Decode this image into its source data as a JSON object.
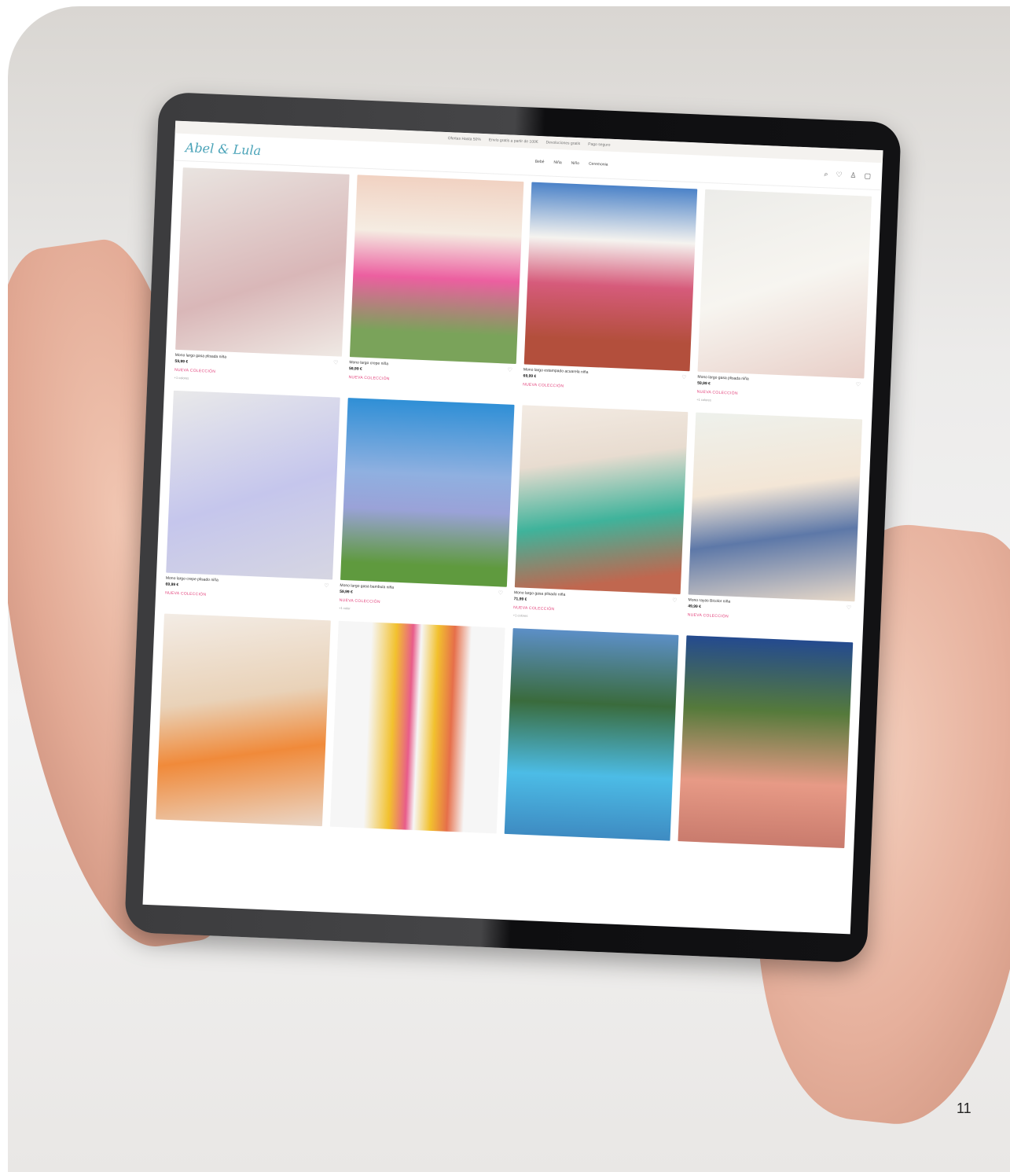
{
  "promo_bar": [
    "Ofertas Hasta 50%",
    "Envío gratis a partir de 100€",
    "Devoluciones gratis",
    "Pago seguro"
  ],
  "brand": "Abel & Lula",
  "nav": [
    "Bebé",
    "Niña",
    "Niño",
    "Ceremonia"
  ],
  "header_icons": [
    "search-icon",
    "heart-icon",
    "user-icon",
    "bag-icon"
  ],
  "products": [
    {
      "name": "Mono largo gasa plisada niña",
      "price": "59,99 €",
      "badge": "NUEVA COLECCIÓN",
      "colors": "+1 colores",
      "bg": "linear-gradient(160deg,#e9e4e0,#d9b7b8 60%,#efe9e4)"
    },
    {
      "name": "Mono largo crepe niña",
      "price": "59,99 €",
      "badge": "NUEVA COLECCIÓN",
      "colors": "",
      "bg": "linear-gradient(180deg,#f1d2c2 0%,#f5ece2 30%,#ec5fa0 55%,#7aa35a 85%)"
    },
    {
      "name": "Mono largo estampado acuarela niña",
      "price": "69,99 €",
      "badge": "NUEVA COLECCIÓN",
      "colors": "",
      "bg": "linear-gradient(180deg,#4b82c8 0%,#f5f3ef 30%,#d65b7b 55%,#b34f3c 85%)"
    },
    {
      "name": "Mono largo gasa plisada niña",
      "price": "59,99 €",
      "badge": "NUEVA COLECCIÓN",
      "colors": "+1 colores",
      "bg": "linear-gradient(160deg,#ecece9,#f7f5f0 50%,#e8cfc8)"
    },
    {
      "name": "Mono largo crepe plisado niña",
      "price": "69,99 €",
      "badge": "NUEVA COLECCIÓN",
      "colors": "",
      "bg": "linear-gradient(160deg,#e9e9ea,#c5c6ec 55%,#d6d6e2)"
    },
    {
      "name": "Mono largo gasa bambula niña",
      "price": "59,99 €",
      "badge": "NUEVA COLECCIÓN",
      "colors": "+1 color",
      "bg": "linear-gradient(180deg,#2f8fd6 0%,#8fb0e0 40%,#9aa2d8 60%,#5f9a3e 90%)"
    },
    {
      "name": "Mono largo gasa plisado niña",
      "price": "71,99 €",
      "badge": "NUEVA COLECCIÓN",
      "colors": "+1 colores",
      "bg": "linear-gradient(170deg,#f3ebe3,#e8dcd0 30%,#3fb39b 60%,#c0674f 90%)"
    },
    {
      "name": "Mono rayas Bicolor niña",
      "price": "49,99 €",
      "badge": "NUEVA COLECCIÓN",
      "colors": "",
      "bg": "linear-gradient(170deg,#eef1ec,#f3e6d6 40%,#5d78a8 65%,#e8d9c9)"
    },
    {
      "name": "",
      "price": "",
      "badge": "",
      "colors": "",
      "bg": "linear-gradient(170deg,#f3ece5,#e9d2b8 40%,#f08a3a 65%,#ead7c8)"
    },
    {
      "name": "",
      "price": "",
      "badge": "",
      "colors": "",
      "bg": "linear-gradient(90deg,#f6f6f6 20%,#f2c12e 35%,#e85c8a 45%,#f6f6f6 50%,#f2c12e 60%,#e66f4a 70%,#f6f6f6 80%)"
    },
    {
      "name": "",
      "price": "",
      "badge": "",
      "colors": "",
      "bg": "linear-gradient(180deg,#5c8fc7 0%,#3a6b3c 35%,#4cbce6 70%,#3e8bc2 100%)"
    },
    {
      "name": "",
      "price": "",
      "badge": "",
      "colors": "",
      "bg": "linear-gradient(180deg,#244a8f 0%,#557a3b 35%,#e79a86 70%,#c97b6d 100%)"
    }
  ],
  "page_number": "11"
}
